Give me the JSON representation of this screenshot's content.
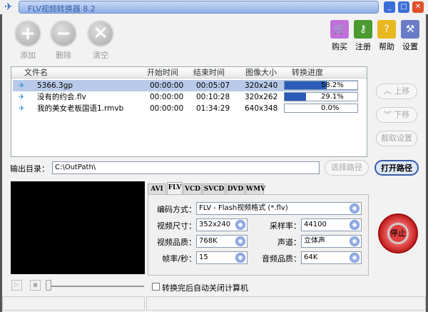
{
  "window": {
    "title": "FLV视频转换器 8.2",
    "minimize": "_",
    "maximize": "□",
    "close": "✕"
  },
  "toolbar": {
    "add": "添加",
    "delete": "删除",
    "clear": "清空",
    "buy": "购买",
    "register": "注册",
    "help": "帮助",
    "settings": "设置"
  },
  "list": {
    "headers": [
      "文件名",
      "开始时间",
      "结束时间",
      "图像大小",
      "转换进度"
    ],
    "rows": [
      {
        "name": "5366.3gp",
        "start": "00:00:00",
        "end": "00:05:07",
        "size": "320x240",
        "progress_text": "58.2%",
        "progress": 58.2
      },
      {
        "name": "没有的约会.flv",
        "start": "00:00:00",
        "end": "00:10:28",
        "size": "320x262",
        "progress_text": "29.1%",
        "progress": 29.1
      },
      {
        "name": "我的美女老板国语1.rmvb",
        "start": "00:00:00",
        "end": "01:34:29",
        "size": "640x348",
        "progress_text": "0.0%",
        "progress": 0
      }
    ]
  },
  "side": {
    "up": "上移",
    "down": "下移",
    "clip": "截取设置"
  },
  "output": {
    "label": "输出目录：",
    "path": "C:\\OutPath\\",
    "choose": "选择路径",
    "open": "打开路径"
  },
  "tabs": [
    "AVI",
    "FLV",
    "VCD",
    "SVCD",
    "DVD",
    "WMV"
  ],
  "settings": {
    "codec_label": "编码方式：",
    "codec": "FLV - Flash视频格式 (*.flv)",
    "vsize_label": "视频尺寸：",
    "vsize": "352x240",
    "rate_label": "采样率：",
    "rate": "44100",
    "vq_label": "视频品质：",
    "vq": "768K",
    "ch_label": "声道：",
    "ch": "立体声",
    "fps_label": "帧率/秒：",
    "fps": "15",
    "aq_label": "音频品质：",
    "aq": "64K"
  },
  "stop": "停止",
  "shutdown": "转换完后自动关闭计算机",
  "player": {
    "play": "▷",
    "stop": "■"
  }
}
